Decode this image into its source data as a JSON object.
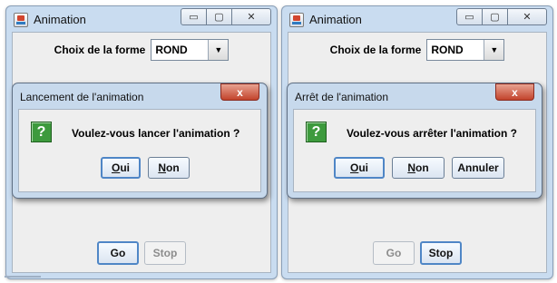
{
  "windows": {
    "left": {
      "title": "Animation",
      "shape_label": "Choix de la forme",
      "shape_value": "ROND",
      "go_label": "Go",
      "stop_label": "Stop"
    },
    "right": {
      "title": "Animation",
      "shape_label": "Choix de la forme",
      "shape_value": "ROND",
      "go_label": "Go",
      "stop_label": "Stop"
    }
  },
  "caption_buttons": {
    "minimize": "▭",
    "maximize": "▢",
    "close": "✕"
  },
  "dialogs": {
    "start": {
      "title": "Lancement de l'animation",
      "message": "Voulez-vous lancer l'animation ?",
      "yes_mnemonic": "O",
      "yes_rest": "ui",
      "no_mnemonic": "N",
      "no_rest": "on",
      "close_glyph": "x"
    },
    "stop": {
      "title": "Arrêt de l'animation",
      "message": "Voulez-vous arrêter l'animation ?",
      "yes_mnemonic": "O",
      "yes_rest": "ui",
      "no_mnemonic": "N",
      "no_rest": "on",
      "cancel_label": "Annuler",
      "close_glyph": "x"
    }
  },
  "icons": {
    "question": "?",
    "dropdown": "▼",
    "question_color": "#3d9a3d",
    "close_color": "#c2432b"
  }
}
